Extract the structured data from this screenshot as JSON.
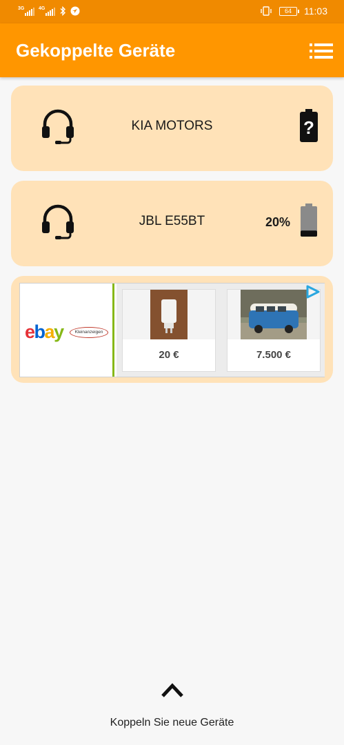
{
  "status_bar": {
    "network_1": "3G",
    "network_2": "4G",
    "battery_level": "64",
    "time": "11:03"
  },
  "app_bar": {
    "title": "Gekoppelte Geräte",
    "menu_icon": "list-menu-icon"
  },
  "devices": [
    {
      "name": "KIA MOTORS",
      "icon": "headset-icon",
      "battery_icon": "battery-unknown-icon",
      "battery_text": ""
    },
    {
      "name": "JBL E55BT",
      "icon": "headset-icon",
      "battery_icon": "battery-low-icon",
      "battery_text": "20%",
      "battery_level": 0.2
    }
  ],
  "ad": {
    "logo_text": "ebay",
    "logo_subtext": "Kleinanzeigen",
    "products": [
      {
        "price": "20 €",
        "image": "usb-charger-photo"
      },
      {
        "price": "7.500 €",
        "image": "vw-bus-photo"
      }
    ],
    "badge_icon": "adchoices-icon"
  },
  "bottom": {
    "icon": "chevron-up-icon",
    "label": "Koppeln Sie neue Geräte"
  },
  "colors": {
    "status_bar": "#f08a00",
    "app_bar": "#ff9600",
    "card": "#ffe2b8"
  }
}
